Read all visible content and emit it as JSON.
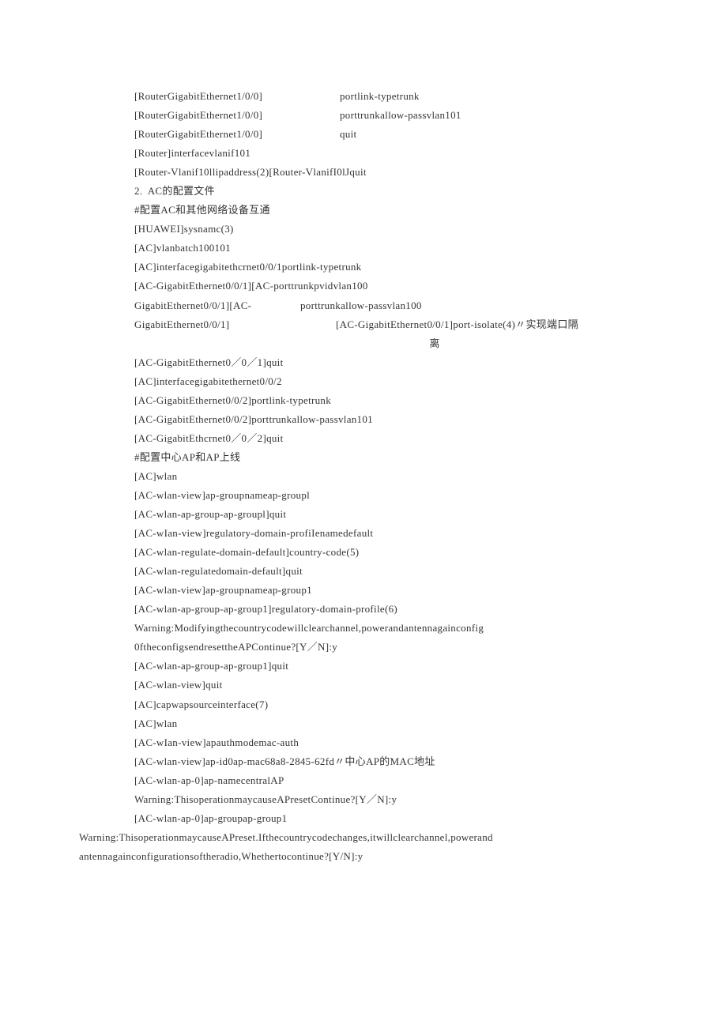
{
  "lines": {
    "l1a": "[RouterGigabitEthernet1/0/0]",
    "l1b": "portlink-typetrunk",
    "l2a": "[RouterGigabitEthernet1/0/0]",
    "l2b": "porttrunkallow-passvlan101",
    "l3a": "[RouterGigabitEthernet1/0/0]",
    "l3b": "quit",
    "l4": "[Router]interfacevlanif101",
    "l5": "[Router-Vlanif10llipaddress(2)[Router-VlanifI0lJquit",
    "l6": "2.  AC的配置文件",
    "l7": "#配置AC和其他网络设备互通",
    "l8": "[HUAWEI]sysnamc(3)",
    "l9": "[AC]vlanbatch100101",
    "l10": "[AC]interfacegigabitethcrnet0/0/1portlink-typetrunk",
    "l11": "[AC-GigabitEthernet0/0/1][AC-porttrunkpvidvlan100",
    "l12a": "GigabitEthernet0/0/1][AC-",
    "l12b": "porttrunkallow-passvlan100",
    "l13a": "GigabitEthernet0/0/1]",
    "l13b": "[AC-GigabitEthernet0/0/1]port-isolate(4)〃实现端口隔",
    "l13c": "离",
    "l14": "[AC-GigabitEthernet0／0／1]quit",
    "l15": "[AC]interfacegigabitethernet0/0/2",
    "l16": "[AC-GigabitEthernet0/0/2]portlink-typetrunk",
    "l17": "[AC-GigabitEthernet0/0/2]porttrunkallow-passvlan101",
    "l18": "[AC-GigabitEthcrnet0／0／2]quit",
    "l19": "#配置中心AP和AP上线",
    "l20": "[AC]wlan",
    "l21": "[AC-wlan-view]ap-groupnameap-groupl",
    "l22": "[AC-wlan-ap-group-ap-groupl]quit",
    "l23": "[AC-wIan-view]regulatory-domain-profiIenamedefault",
    "l24": "[AC-wlan-regulate-domain-default]country-code(5)",
    "l25": "[AC-wlan-regulatedomain-default]quit",
    "l26": "[AC-wlan-view]ap-groupnameap-group1",
    "l27": "[AC-wlan-ap-group-ap-group1]regulatory-domain-profile(6)",
    "l28": "Warning:Modifyingthecountrycodewillclearchannel,powerandantennagainconfig",
    "l29": "0ftheconfigsendresettheAPContinue?[Y／N]:y",
    "l30": "[AC-wlan-ap-group-ap-group1]quit",
    "l31": "[AC-wlan-view]quit",
    "l32": "[AC]capwapsourceinterface(7)",
    "l33": "[AC]wlan",
    "l34": "[AC-wIan-view]apauthmodemac-auth",
    "l35": "[AC-wlan-view]ap-id0ap-mac68a8-2845-62fd〃中心AP的MAC地址",
    "l36": "[AC-wlan-ap-0]ap-namecentralAP",
    "l37": "Warning:ThisoperationmaycauseAPresetContinue?[Y／N]:y",
    "l38": "[AC-wlan-ap-0]ap-groupap-group1",
    "l39": "    Warning:ThisoperationmaycauseAPreset.Ifthecountrycodechanges,itwillclearchannel,powerand antennagainconfigurationsoftheradio,Whethertocontinue?[Y/N]:y"
  }
}
